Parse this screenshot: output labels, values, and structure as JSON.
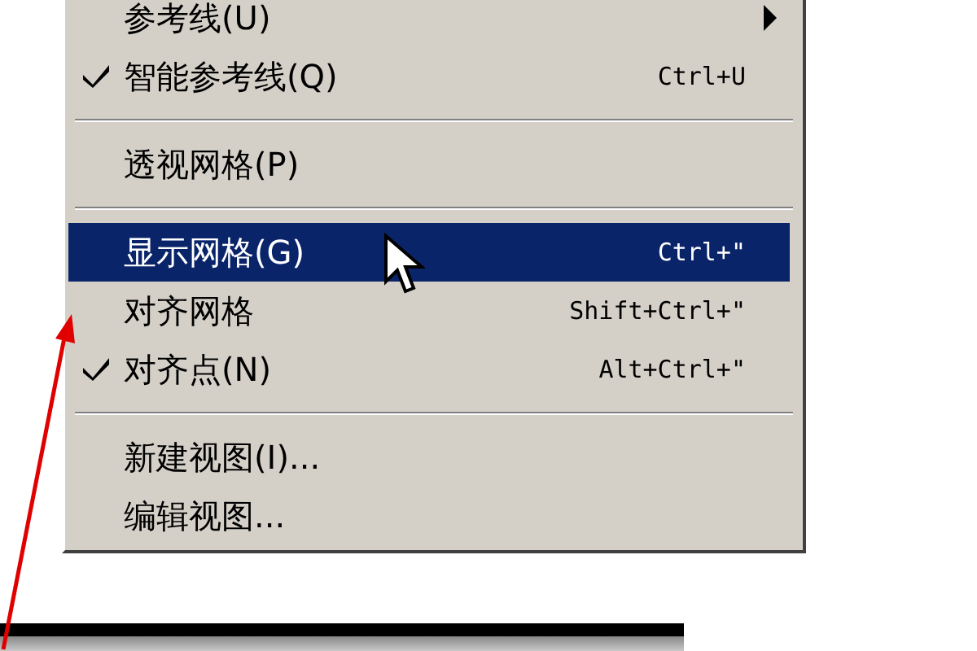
{
  "menu": {
    "items": [
      {
        "kind": "item",
        "label": "参考线(U)",
        "checked": false,
        "submenu": true,
        "selected": false
      },
      {
        "kind": "item",
        "label": "智能参考线(Q)",
        "shortcut": "Ctrl+U",
        "checked": true,
        "submenu": false,
        "selected": false
      },
      {
        "kind": "separator"
      },
      {
        "kind": "item",
        "label": "透视网格(P)",
        "checked": false,
        "submenu": false,
        "selected": false
      },
      {
        "kind": "separator"
      },
      {
        "kind": "item",
        "label": "显示网格(G)",
        "shortcut": "Ctrl+\"",
        "checked": false,
        "submenu": false,
        "selected": true
      },
      {
        "kind": "item",
        "label": "对齐网格",
        "shortcut": "Shift+Ctrl+\"",
        "checked": false,
        "submenu": false,
        "selected": false
      },
      {
        "kind": "item",
        "label": "对齐点(N)",
        "shortcut": "Alt+Ctrl+\"",
        "checked": true,
        "submenu": false,
        "selected": false
      },
      {
        "kind": "separator"
      },
      {
        "kind": "item",
        "label": "新建视图(I)...",
        "checked": false,
        "submenu": false,
        "selected": false
      },
      {
        "kind": "item",
        "label": "编辑视图...",
        "checked": false,
        "submenu": false,
        "selected": false
      }
    ]
  }
}
